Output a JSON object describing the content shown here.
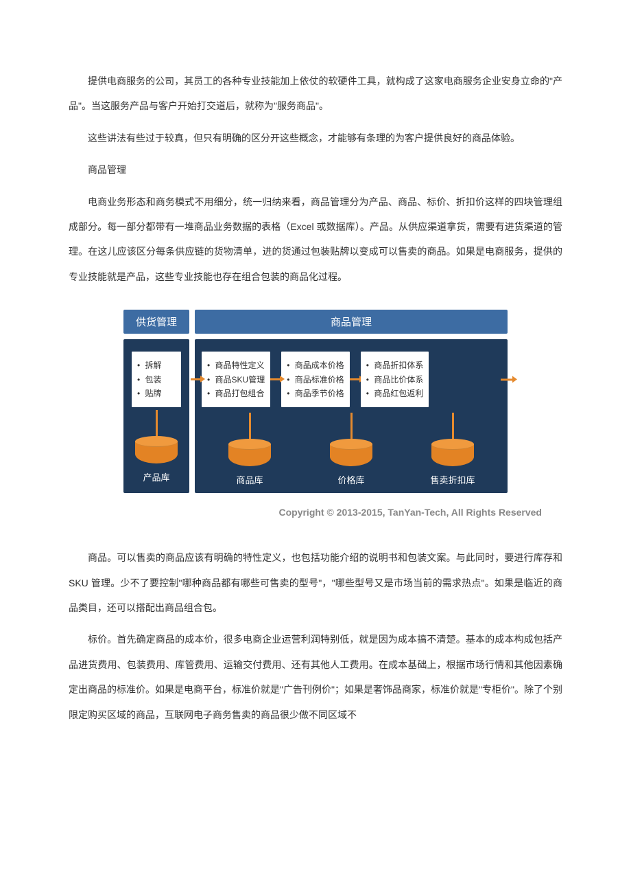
{
  "paragraphs": {
    "p1": "提供电商服务的公司，其员工的各种专业技能加上依仗的软硬件工具，就构成了这家电商服务企业安身立命的\"产品\"。当这服务产品与客户开始打交道后，就称为\"服务商品\"。",
    "p2": "这些讲法有些过于较真，但只有明确的区分开这些概念，才能够有条理的为客户提供良好的商品体验。",
    "heading": "商品管理",
    "p3": "电商业务形态和商务模式不用细分，统一归纳来看，商品管理分为产品、商品、标价、折扣价这样的四块管理组成部分。每一部分都带有一堆商品业务数据的表格（Excel 或数据库）。产品。从供应渠道拿货，需要有进货渠道的管理。在这儿应该区分每条供应链的货物清单，进的货通过包装贴牌以变成可以售卖的商品。如果是电商服务，提供的专业技能就是产品，这些专业技能也存在组合包装的商品化过程。",
    "p4": "商品。可以售卖的商品应该有明确的特性定义，也包括功能介绍的说明书和包装文案。与此同时，要进行库存和 SKU 管理。少不了要控制\"哪种商品都有哪些可售卖的型号\"，\"哪些型号又是市场当前的需求热点\"。如果是临近的商品类目，还可以搭配出商品组合包。",
    "p5": "标价。首先确定商品的成本价，很多电商企业运营利润特别低，就是因为成本搞不清楚。基本的成本构成包括产品进货费用、包装费用、库管费用、运输交付费用、还有其他人工费用。在成本基础上，根据市场行情和其他因素确定出商品的标准价。如果是电商平台，标准价就是\"广告刊例价\"；如果是奢饰品商家，标准价就是\"专柜价\"。除了个别限定购买区域的商品，互联网电子商务售卖的商品很少做不同区域不"
  },
  "diagram": {
    "header_left": "供货管理",
    "header_right": "商品管理",
    "left_box": [
      "拆解",
      "包装",
      "贴牌"
    ],
    "right_box1": [
      "商品特性定义",
      "商品SKU管理",
      "商品打包组合"
    ],
    "right_box2": [
      "商品成本价格",
      "商品标准价格",
      "商品季节价格"
    ],
    "right_box3": [
      "商品折扣体系",
      "商品比价体系",
      "商品红包返利"
    ],
    "db_labels": {
      "left": "产品库",
      "r1": "商品库",
      "r2": "价格库",
      "r3": "售卖折扣库"
    }
  },
  "copyright": "Copyright © 2013-2015, TanYan-Tech, All Rights Reserved"
}
